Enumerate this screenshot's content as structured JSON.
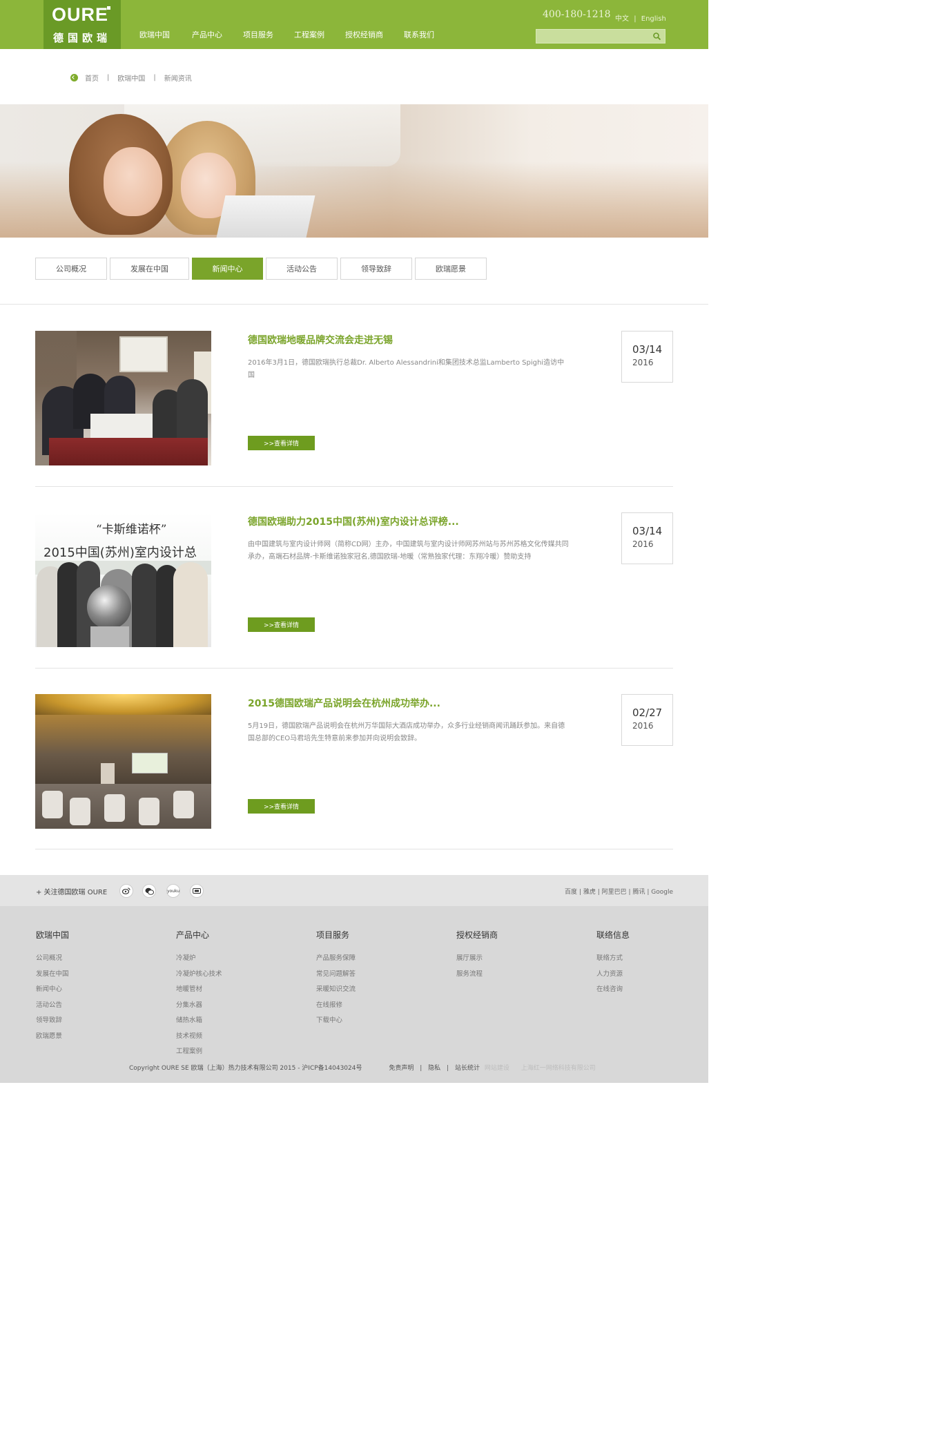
{
  "header": {
    "logo_en": "OURE",
    "logo_cn": "德国欧瑞",
    "nav": [
      "欧瑞中国",
      "产品中心",
      "项目服务",
      "工程案例",
      "授权经销商",
      "联系我们"
    ],
    "phone": "400-180-1218",
    "lang_cn": "中文",
    "lang_sep": "|",
    "lang_en": "English",
    "search_placeholder": ""
  },
  "breadcrumb": {
    "items": [
      "首页",
      "欧瑞中国",
      "新闻资讯"
    ],
    "sep": "|"
  },
  "tabs": {
    "items": [
      "公司概况",
      "发展在中国",
      "新闻中心",
      "活动公告",
      "领导致辞",
      "欧瑞愿景"
    ],
    "active_index": 2
  },
  "news": [
    {
      "title": "德国欧瑞地暖品牌交流会走进无锡",
      "desc": "2016年3月1日，德国欧瑞执行总裁Dr. Alberto Alessandrini和集团技术总监Lamberto Spighi造访中国",
      "button": ">>查看详情",
      "date_md": "03/14",
      "date_y": "2016"
    },
    {
      "title": "德国欧瑞助力2015中国(苏州)室内设计总评榜...",
      "desc": "由中国建筑与室内设计师网（简称CD网）主办，中国建筑与室内设计师网苏州站与苏州苏格文化传媒共同承办，高端石材品牌-卡斯维诺独家冠名,德国欧瑞-地暖（常熟独家代理：东翔冷暖）赞助支持",
      "button": ">>查看详情",
      "date_md": "03/14",
      "date_y": "2016",
      "img_text_1": "“卡斯维诺杯”",
      "img_text_2": "2015中国(苏州)室内设计总"
    },
    {
      "title": "2015德国欧瑞产品说明会在杭州成功举办...",
      "desc": "5月19日，德国欧瑞产品说明会在杭州万华国际大酒店成功举办，众多行业经销商闻讯踊跃参加。来自德国总部的CEO马君培先生特意前来参加并向说明会致辞。",
      "button": ">>查看详情",
      "date_md": "02/27",
      "date_y": "2016"
    }
  ],
  "follow": {
    "text": "+ 关注德国欧瑞 OURE",
    "social_icons": [
      "weibo-icon",
      "wechat-icon",
      "youku-icon",
      "tudou-icon"
    ],
    "engines": [
      "百度",
      "雅虎",
      "阿里巴巴",
      "腾讯",
      "Google"
    ],
    "engines_sep": "|"
  },
  "footer": {
    "columns": [
      {
        "title": "欧瑞中国",
        "links": [
          "公司概况",
          "发展在中国",
          "新闻中心",
          "活动公告",
          "领导致辞",
          "欧瑞愿景"
        ]
      },
      {
        "title": "产品中心",
        "links": [
          "冷凝炉",
          "冷凝炉核心技术",
          "地暖管材",
          "分集水器",
          "储热水箱",
          "技术视频",
          "工程案例"
        ]
      },
      {
        "title": "项目服务",
        "links": [
          "产品服务保障",
          "常见问题解答",
          "采暖知识交流",
          "在线报修",
          "下载中心"
        ]
      },
      {
        "title": "授权经销商",
        "links": [
          "展厅展示",
          "服务流程"
        ]
      },
      {
        "title": "联络信息",
        "links": [
          "联络方式",
          "人力资源",
          "在线咨询"
        ]
      }
    ],
    "copyright": "Copyright OURE SE 欧瑞（上海）热力技术有限公司 2015 - 沪ICP备14043024号",
    "links": [
      "免责声明",
      "隐私",
      "站长统计"
    ],
    "sep": "|",
    "faint_1": "网站建设",
    "faint_2": "上海红一网络科技有限公司"
  },
  "colors": {
    "brand_green": "#8cb63a",
    "logo_green": "#6a9a26",
    "active_tab": "#7aa42a",
    "title_green": "#7aa42a",
    "footer_bg": "#d8d8d8"
  }
}
